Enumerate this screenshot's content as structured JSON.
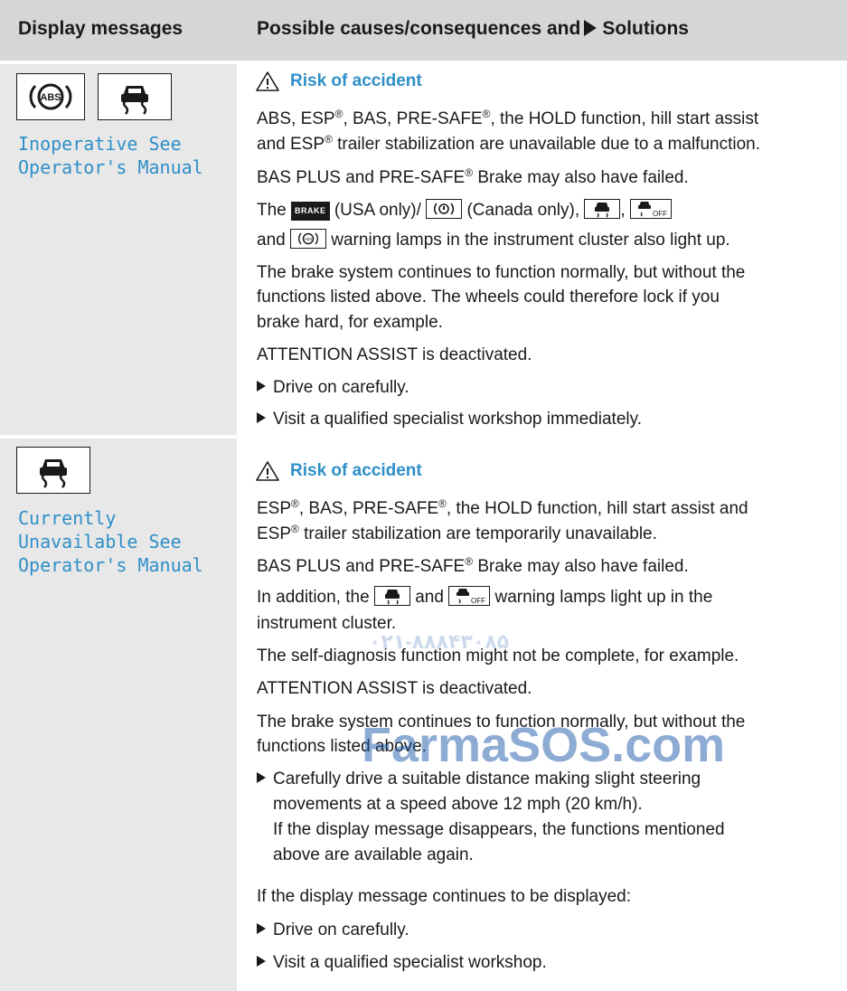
{
  "header": {
    "col1": "Display messages",
    "col2_prefix": "Possible causes/consequences and",
    "col2_suffix": "Solutions"
  },
  "rows": [
    {
      "icons": [
        "abs-warning-icon",
        "esp-skid-icon"
      ],
      "message_lines": [
        "Inoperative See",
        "Operator's Manual"
      ],
      "warning": "Risk of accident",
      "p1_line1": "ABS, ESP®, BAS, PRE-SAFE®, the HOLD function, hill start assist",
      "p1_line2": "and ESP® trailer stabilization are unavailable due to a malfunction.",
      "p2": "BAS PLUS and PRE-SAFE® Brake may also have failed.",
      "p3_a": "The",
      "p3_b": "(USA only)/",
      "p3_c": "(Canada only),",
      "p3_d": "and",
      "p3_e": "warning lamps in the instrument cluster also light up.",
      "brake_label": "BRAKE",
      "p4_line1": "The brake system continues to function normally, but without the",
      "p4_line2": "functions listed above. The wheels could therefore lock if you",
      "p4_line3": "brake hard, for example.",
      "p5": "ATTENTION ASSIST is deactivated.",
      "bullets": [
        "Drive on carefully.",
        "Visit a qualified specialist workshop immediately."
      ]
    },
    {
      "icons": [
        "esp-skid-icon"
      ],
      "message_lines": [
        "Currently",
        "Unavailable See",
        "Operator's Manual"
      ],
      "warning": "Risk of accident",
      "p1_line1": "ESP®, BAS, PRE-SAFE®, the HOLD function, hill start assist and",
      "p1_line2": "ESP® trailer stabilization are temporarily unavailable.",
      "p2": "BAS PLUS and PRE-SAFE® Brake may also have failed.",
      "p3_a": "In addition, the",
      "p3_b": "and",
      "p3_c": "warning lamps light up in the",
      "p3_line2": "instrument cluster.",
      "p4": "The self-diagnosis function might not be complete, for example.",
      "p5": "ATTENTION ASSIST is deactivated.",
      "p6_line1": "The brake system continues to function normally, but without the",
      "p6_line2": "functions listed above.",
      "bullet1_line1": "Carefully drive a suitable distance making slight steering",
      "bullet1_line2": "movements at a speed above 12 mph (20 km/h).",
      "bullet1_line3": "If the display message disappears, the functions mentioned",
      "bullet1_line4": "above are available again.",
      "p7": "If the display message continues to be displayed:",
      "bullets": [
        "Drive on carefully.",
        "Visit a qualified specialist workshop."
      ]
    }
  ],
  "watermark": {
    "site": "FarmaSOS.com",
    "phone": "۰۲۱-۸۸۸۴۳۰۸۵",
    "color": "#1f5aa8"
  }
}
